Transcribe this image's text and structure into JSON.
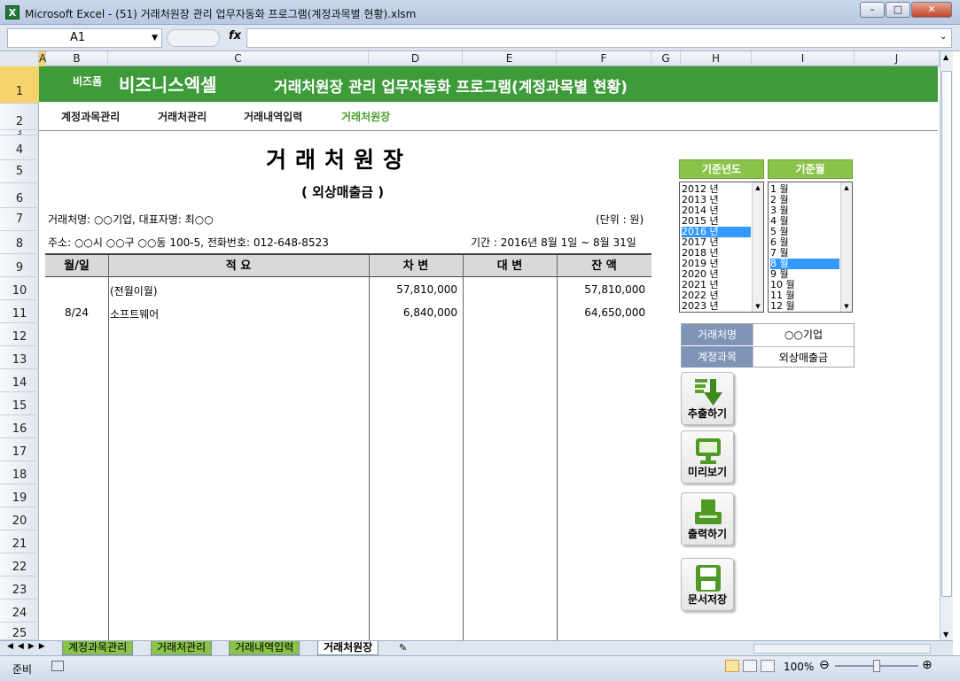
{
  "window": {
    "title": "Microsoft Excel - (51) 거래처원장 관리 업무자동화 프로그램(계정과목별 현황).xlsm",
    "icon": "excel-icon"
  },
  "formula": {
    "namebox": "A1",
    "fx": "fx",
    "value": ""
  },
  "columns": [
    "A",
    "B",
    "C",
    "D",
    "E",
    "F",
    "G",
    "H",
    "I",
    "J"
  ],
  "rows": [
    "1",
    "2",
    "3",
    "4",
    "5",
    "6",
    "7",
    "8",
    "9",
    "10",
    "11",
    "12",
    "13",
    "14",
    "15",
    "16",
    "17",
    "18",
    "19",
    "20",
    "21",
    "22",
    "23",
    "24",
    "25"
  ],
  "header": {
    "brand_small": "비즈폼",
    "brand_big": "비즈니스엑셀",
    "title": "거래처원장 관리 업무자동화 프로그램(계정과목별 현황)"
  },
  "nav": {
    "items": [
      "계정과목관리",
      "거래처관리",
      "거래내역입력",
      "거래처원장"
    ],
    "active": "거래처원장"
  },
  "ledger": {
    "title": "거래처원장",
    "subtitle": "( 외상매출금 )",
    "client_line": "거래처명: ○○기업,  대표자명: 최○○",
    "unit": "(단위 : 원)",
    "address_line": "주소: ○○시 ○○구 ○○동 100-5,  전화번호: 012-648-8523",
    "period": "기간 : 2016년 8월 1일 ~ 8월 31일",
    "columns": [
      "월/일",
      "적 요",
      "차 변",
      "대 변",
      "잔 액"
    ],
    "rows": [
      {
        "date": "",
        "desc": "(전월이월)",
        "debit": "57,810,000",
        "credit": "",
        "balance": "57,810,000"
      },
      {
        "date": "8/24",
        "desc": "소프트웨어",
        "debit": "6,840,000",
        "credit": "",
        "balance": "64,650,000"
      }
    ]
  },
  "year_list": {
    "header": "기준년도",
    "items": [
      "2012 년",
      "2013 년",
      "2014 년",
      "2015 년",
      "2016 년",
      "2017 년",
      "2018 년",
      "2019 년",
      "2020 년",
      "2021 년",
      "2022 년",
      "2023 년"
    ],
    "selected": "2016 년"
  },
  "month_list": {
    "header": "기준월",
    "items": [
      "1 월",
      "2 월",
      "3 월",
      "4 월",
      "5 월",
      "6 월",
      "7 월",
      "8 월",
      "9 월",
      "10 월",
      "11 월",
      "12 월"
    ],
    "selected": "8 월"
  },
  "info_table": {
    "client_label": "거래처명",
    "client_value": "○○기업",
    "account_label": "계정과목",
    "account_value": "외상매출금"
  },
  "buttons": {
    "extract": "추출하기",
    "preview": "미리보기",
    "print": "출력하기",
    "save": "문서저장"
  },
  "sheet_tabs": [
    "계정과목관리",
    "거래처관리",
    "거래내역입력",
    "거래처원장"
  ],
  "active_tab": "거래처원장",
  "status": {
    "ready": "준비",
    "zoom": "100%"
  },
  "colors": {
    "green": "#3d9b3a",
    "header_green": "#8ac349",
    "label_blue": "#8094b8",
    "selection": "#3399ff"
  }
}
